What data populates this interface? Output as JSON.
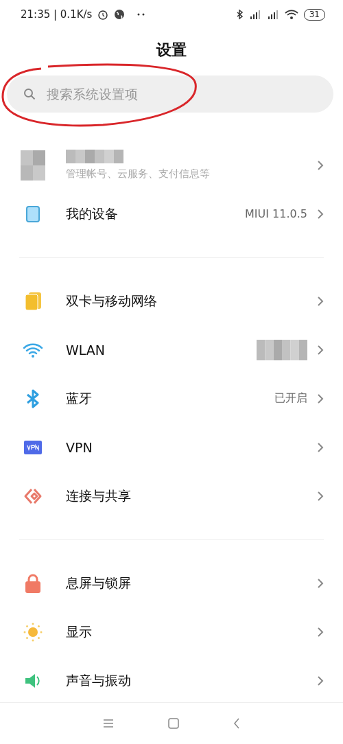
{
  "status_bar": {
    "time": "21:35 | 0.1K/s",
    "battery": "31"
  },
  "title": "设置",
  "search": {
    "placeholder": "搜索系统设置项",
    "circled": true
  },
  "account": {
    "subtitle": "管理帐号、云服务、支付信息等"
  },
  "sections": [
    {
      "items": [
        {
          "kind": "device",
          "label": "我的设备",
          "value": "MIUI 11.0.5",
          "redacted": false
        }
      ]
    },
    {
      "items": [
        {
          "kind": "sim",
          "label": "双卡与移动网络",
          "redacted": false
        },
        {
          "kind": "wifi",
          "label": "WLAN",
          "redacted": true
        },
        {
          "kind": "bluetooth",
          "label": "蓝牙",
          "value": "已开启",
          "redacted": false
        },
        {
          "kind": "vpn",
          "label": "VPN",
          "redacted": false
        },
        {
          "kind": "share",
          "label": "连接与共享",
          "redacted": false
        }
      ]
    },
    {
      "items": [
        {
          "kind": "lock",
          "label": "息屏与锁屏",
          "redacted": false
        },
        {
          "kind": "sun",
          "label": "显示",
          "redacted": false
        },
        {
          "kind": "sound",
          "label": "声音与振动",
          "redacted": false
        }
      ]
    }
  ]
}
